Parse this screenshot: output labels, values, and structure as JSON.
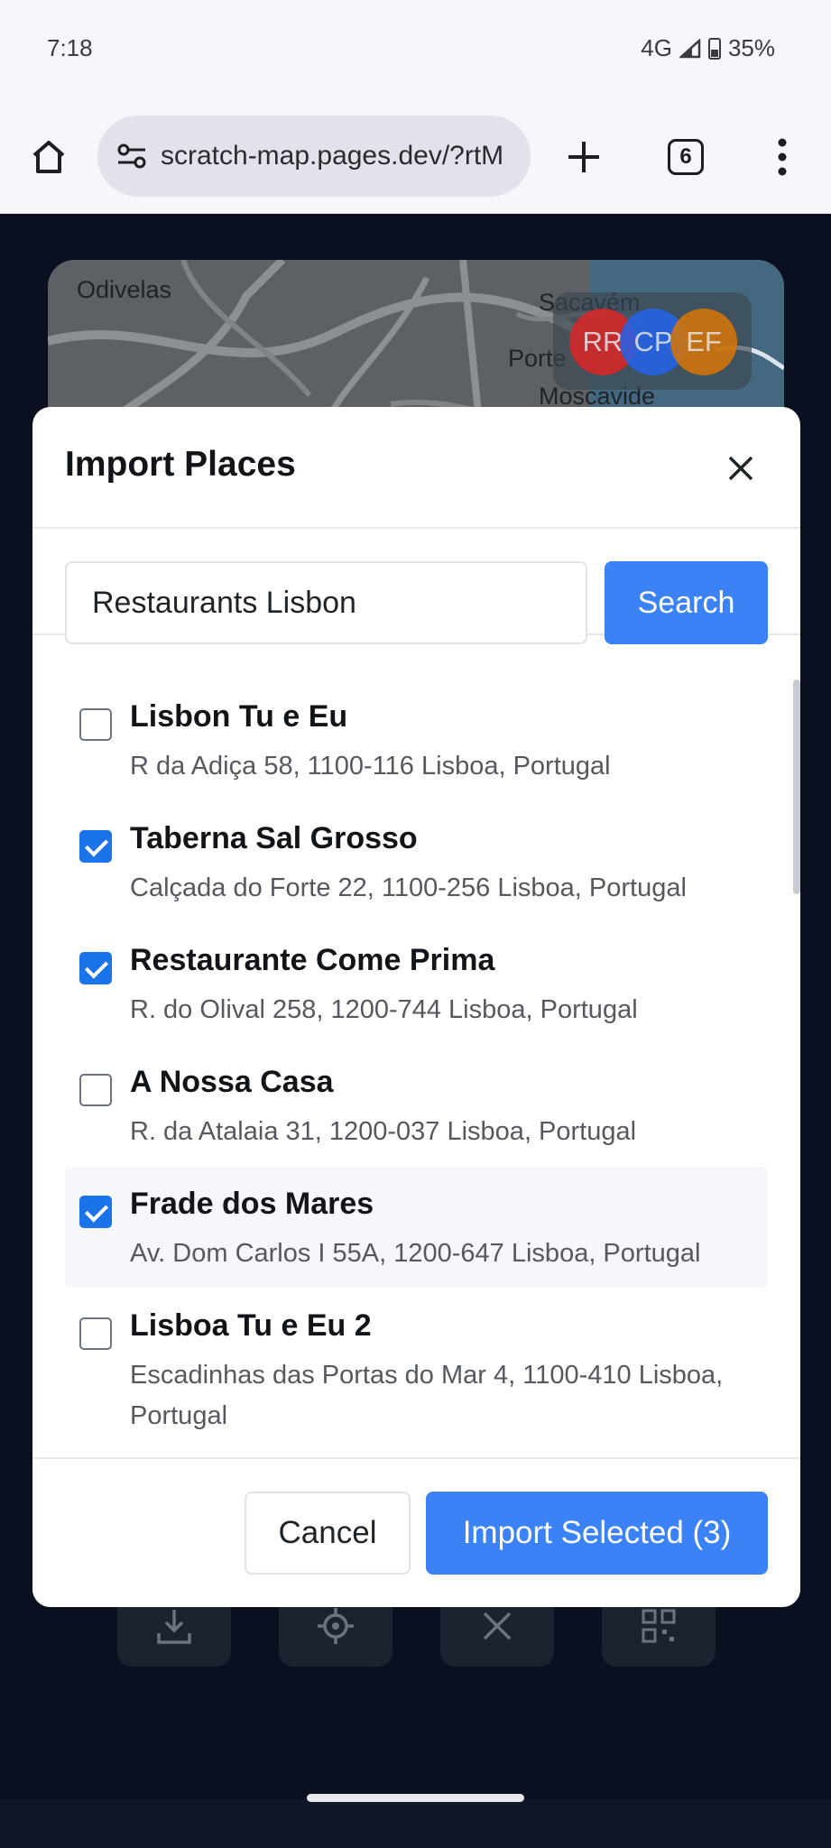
{
  "status_bar": {
    "time": "7:18",
    "network": "4G",
    "battery": "35%"
  },
  "browser": {
    "url": "scratch-map.pages.dev/?rtM",
    "tab_count": "6",
    "icons": [
      "home-icon",
      "site-settings-icon",
      "plus-icon",
      "tabs-icon",
      "more-vert-icon"
    ]
  },
  "map": {
    "labels": [
      "Odivelas",
      "Sacavém",
      "Porte",
      "Moscavide"
    ],
    "avatars": [
      {
        "initials": "RR",
        "color": "#dc2626"
      },
      {
        "initials": "CP",
        "color": "#2563eb"
      },
      {
        "initials": "EF",
        "color": "#d97706"
      }
    ]
  },
  "modal": {
    "title": "Import Places",
    "search": {
      "value": "Restaurants Lisbon",
      "button_label": "Search"
    },
    "results": [
      {
        "name": "Lisbon Tu e Eu",
        "address": "R da Adiça 58, 1100-116 Lisboa, Portugal",
        "checked": false
      },
      {
        "name": "Taberna Sal Grosso",
        "address": "Calçada do Forte 22, 1100-256 Lisboa, Portugal",
        "checked": true
      },
      {
        "name": "Restaurante Come Prima",
        "address": "R. do Olival 258, 1200-744 Lisboa, Portugal",
        "checked": true
      },
      {
        "name": "A Nossa Casa",
        "address": "R. da Atalaia 31, 1200-037 Lisboa, Portugal",
        "checked": false
      },
      {
        "name": "Frade dos Mares",
        "address": "Av. Dom Carlos I 55A, 1200-647 Lisboa, Portugal",
        "checked": true
      },
      {
        "name": "Lisboa Tu e Eu 2",
        "address": "Escadinhas das Portas do Mar 4, 1100-410 Lisboa, Portugal",
        "checked": false
      }
    ],
    "footer": {
      "cancel_label": "Cancel",
      "import_label": "Import Selected (3)"
    }
  },
  "colors": {
    "primary": "#3b82f6",
    "checkbox": "#1a73e8",
    "page_bg": "#0b1020"
  }
}
